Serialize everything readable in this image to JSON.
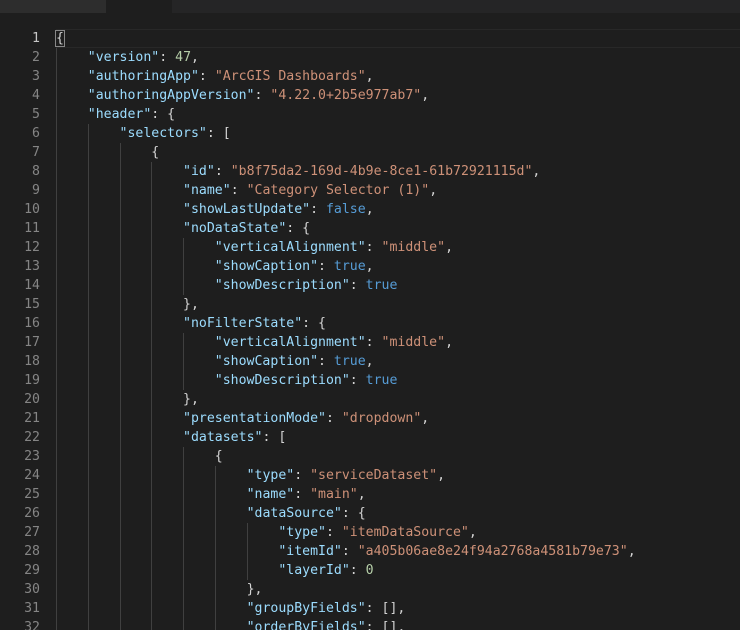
{
  "editor": {
    "indent_unit": "    ",
    "active_line": 1,
    "colors": {
      "background": "#1e1e1e",
      "key": "#9cdcfe",
      "string": "#ce9178",
      "number": "#b5cea8",
      "boolean": "#569cd6",
      "punctuation": "#d4d4d4",
      "line_number": "#858585"
    },
    "lines": [
      {
        "n": "1",
        "indent": 0,
        "tokens": [
          {
            "t": "p",
            "v": "{",
            "bm": true
          }
        ]
      },
      {
        "n": "2",
        "indent": 1,
        "tokens": [
          {
            "t": "k",
            "v": "\"version\""
          },
          {
            "t": "p",
            "v": ": "
          },
          {
            "t": "n",
            "v": "47"
          },
          {
            "t": "p",
            "v": ","
          }
        ]
      },
      {
        "n": "3",
        "indent": 1,
        "tokens": [
          {
            "t": "k",
            "v": "\"authoringApp\""
          },
          {
            "t": "p",
            "v": ": "
          },
          {
            "t": "s",
            "v": "\"ArcGIS Dashboards\""
          },
          {
            "t": "p",
            "v": ","
          }
        ]
      },
      {
        "n": "4",
        "indent": 1,
        "tokens": [
          {
            "t": "k",
            "v": "\"authoringAppVersion\""
          },
          {
            "t": "p",
            "v": ": "
          },
          {
            "t": "s",
            "v": "\"4.22.0+2b5e977ab7\""
          },
          {
            "t": "p",
            "v": ","
          }
        ]
      },
      {
        "n": "5",
        "indent": 1,
        "tokens": [
          {
            "t": "k",
            "v": "\"header\""
          },
          {
            "t": "p",
            "v": ": {"
          }
        ]
      },
      {
        "n": "6",
        "indent": 2,
        "tokens": [
          {
            "t": "k",
            "v": "\"selectors\""
          },
          {
            "t": "p",
            "v": ": ["
          }
        ]
      },
      {
        "n": "7",
        "indent": 3,
        "tokens": [
          {
            "t": "p",
            "v": "{"
          }
        ]
      },
      {
        "n": "8",
        "indent": 4,
        "tokens": [
          {
            "t": "k",
            "v": "\"id\""
          },
          {
            "t": "p",
            "v": ": "
          },
          {
            "t": "s",
            "v": "\"b8f75da2-169d-4b9e-8ce1-61b72921115d\""
          },
          {
            "t": "p",
            "v": ","
          }
        ]
      },
      {
        "n": "9",
        "indent": 4,
        "tokens": [
          {
            "t": "k",
            "v": "\"name\""
          },
          {
            "t": "p",
            "v": ": "
          },
          {
            "t": "s",
            "v": "\"Category Selector (1)\""
          },
          {
            "t": "p",
            "v": ","
          }
        ]
      },
      {
        "n": "10",
        "indent": 4,
        "tokens": [
          {
            "t": "k",
            "v": "\"showLastUpdate\""
          },
          {
            "t": "p",
            "v": ": "
          },
          {
            "t": "b",
            "v": "false"
          },
          {
            "t": "p",
            "v": ","
          }
        ]
      },
      {
        "n": "11",
        "indent": 4,
        "tokens": [
          {
            "t": "k",
            "v": "\"noDataState\""
          },
          {
            "t": "p",
            "v": ": {"
          }
        ]
      },
      {
        "n": "12",
        "indent": 5,
        "tokens": [
          {
            "t": "k",
            "v": "\"verticalAlignment\""
          },
          {
            "t": "p",
            "v": ": "
          },
          {
            "t": "s",
            "v": "\"middle\""
          },
          {
            "t": "p",
            "v": ","
          }
        ]
      },
      {
        "n": "13",
        "indent": 5,
        "tokens": [
          {
            "t": "k",
            "v": "\"showCaption\""
          },
          {
            "t": "p",
            "v": ": "
          },
          {
            "t": "b",
            "v": "true"
          },
          {
            "t": "p",
            "v": ","
          }
        ]
      },
      {
        "n": "14",
        "indent": 5,
        "tokens": [
          {
            "t": "k",
            "v": "\"showDescription\""
          },
          {
            "t": "p",
            "v": ": "
          },
          {
            "t": "b",
            "v": "true"
          }
        ]
      },
      {
        "n": "15",
        "indent": 4,
        "tokens": [
          {
            "t": "p",
            "v": "},"
          }
        ]
      },
      {
        "n": "16",
        "indent": 4,
        "tokens": [
          {
            "t": "k",
            "v": "\"noFilterState\""
          },
          {
            "t": "p",
            "v": ": {"
          }
        ]
      },
      {
        "n": "17",
        "indent": 5,
        "tokens": [
          {
            "t": "k",
            "v": "\"verticalAlignment\""
          },
          {
            "t": "p",
            "v": ": "
          },
          {
            "t": "s",
            "v": "\"middle\""
          },
          {
            "t": "p",
            "v": ","
          }
        ]
      },
      {
        "n": "18",
        "indent": 5,
        "tokens": [
          {
            "t": "k",
            "v": "\"showCaption\""
          },
          {
            "t": "p",
            "v": ": "
          },
          {
            "t": "b",
            "v": "true"
          },
          {
            "t": "p",
            "v": ","
          }
        ]
      },
      {
        "n": "19",
        "indent": 5,
        "tokens": [
          {
            "t": "k",
            "v": "\"showDescription\""
          },
          {
            "t": "p",
            "v": ": "
          },
          {
            "t": "b",
            "v": "true"
          }
        ]
      },
      {
        "n": "20",
        "indent": 4,
        "tokens": [
          {
            "t": "p",
            "v": "},"
          }
        ]
      },
      {
        "n": "21",
        "indent": 4,
        "tokens": [
          {
            "t": "k",
            "v": "\"presentationMode\""
          },
          {
            "t": "p",
            "v": ": "
          },
          {
            "t": "s",
            "v": "\"dropdown\""
          },
          {
            "t": "p",
            "v": ","
          }
        ]
      },
      {
        "n": "22",
        "indent": 4,
        "tokens": [
          {
            "t": "k",
            "v": "\"datasets\""
          },
          {
            "t": "p",
            "v": ": ["
          }
        ]
      },
      {
        "n": "23",
        "indent": 5,
        "tokens": [
          {
            "t": "p",
            "v": "{"
          }
        ]
      },
      {
        "n": "24",
        "indent": 6,
        "tokens": [
          {
            "t": "k",
            "v": "\"type\""
          },
          {
            "t": "p",
            "v": ": "
          },
          {
            "t": "s",
            "v": "\"serviceDataset\""
          },
          {
            "t": "p",
            "v": ","
          }
        ]
      },
      {
        "n": "25",
        "indent": 6,
        "tokens": [
          {
            "t": "k",
            "v": "\"name\""
          },
          {
            "t": "p",
            "v": ": "
          },
          {
            "t": "s",
            "v": "\"main\""
          },
          {
            "t": "p",
            "v": ","
          }
        ]
      },
      {
        "n": "26",
        "indent": 6,
        "tokens": [
          {
            "t": "k",
            "v": "\"dataSource\""
          },
          {
            "t": "p",
            "v": ": {"
          }
        ]
      },
      {
        "n": "27",
        "indent": 7,
        "tokens": [
          {
            "t": "k",
            "v": "\"type\""
          },
          {
            "t": "p",
            "v": ": "
          },
          {
            "t": "s",
            "v": "\"itemDataSource\""
          },
          {
            "t": "p",
            "v": ","
          }
        ]
      },
      {
        "n": "28",
        "indent": 7,
        "tokens": [
          {
            "t": "k",
            "v": "\"itemId\""
          },
          {
            "t": "p",
            "v": ": "
          },
          {
            "t": "s",
            "v": "\"a405b06ae8e24f94a2768a4581b79e73\""
          },
          {
            "t": "p",
            "v": ","
          }
        ]
      },
      {
        "n": "29",
        "indent": 7,
        "tokens": [
          {
            "t": "k",
            "v": "\"layerId\""
          },
          {
            "t": "p",
            "v": ": "
          },
          {
            "t": "n",
            "v": "0"
          }
        ]
      },
      {
        "n": "30",
        "indent": 6,
        "tokens": [
          {
            "t": "p",
            "v": "},"
          }
        ]
      },
      {
        "n": "31",
        "indent": 6,
        "tokens": [
          {
            "t": "k",
            "v": "\"groupByFields\""
          },
          {
            "t": "p",
            "v": ": [],"
          }
        ]
      },
      {
        "n": "32",
        "indent": 6,
        "tokens": [
          {
            "t": "k",
            "v": "\"orderByFields\""
          },
          {
            "t": "p",
            "v": ": [],"
          }
        ]
      }
    ]
  }
}
